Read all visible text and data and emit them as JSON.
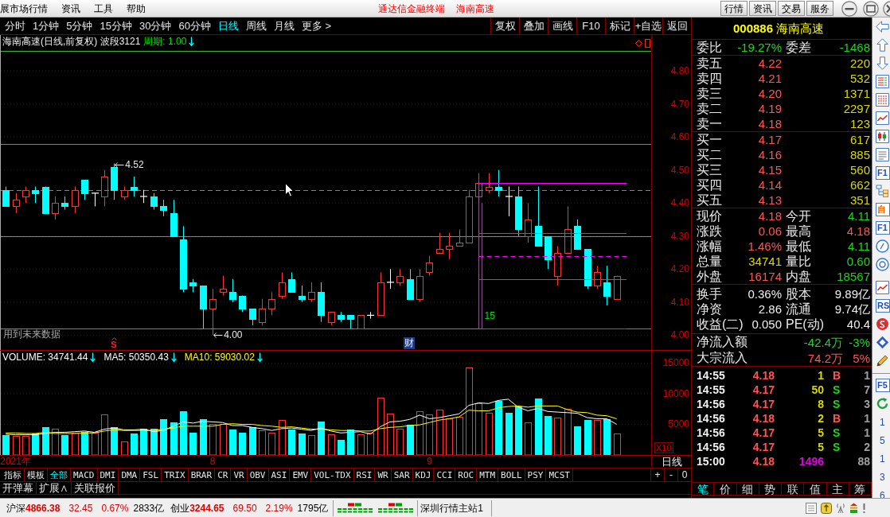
{
  "title_bar": {
    "menus": [
      "展市场行情",
      "资讯",
      "工具",
      "帮助"
    ],
    "app_name": "通达信金融终端",
    "stock_name": "海南高速",
    "buttons": [
      "行情",
      "资讯",
      "交易",
      "服务"
    ]
  },
  "toolbar": {
    "periods": [
      {
        "label": "分时",
        "selected": false
      },
      {
        "label": "1分钟",
        "selected": false
      },
      {
        "label": "5分钟",
        "selected": false
      },
      {
        "label": "15分钟",
        "selected": false
      },
      {
        "label": "30分钟",
        "selected": false
      },
      {
        "label": "60分钟",
        "selected": false
      },
      {
        "label": "日线",
        "selected": true
      },
      {
        "label": "周线",
        "selected": false
      },
      {
        "label": "月线",
        "selected": false
      },
      {
        "label": "更多 >",
        "selected": false
      }
    ],
    "tools": [
      "复权",
      "叠加",
      "画线",
      "F10",
      "标记",
      "+自选",
      "返回"
    ]
  },
  "price_panel": {
    "title": "海南高速(日线,前复权) 波段3121",
    "period_label": "周期: 1.00",
    "notice": "用到未来数据",
    "chart_data": [
      {
        "type": "candlestick",
        "ohlc": [
          [
            4.44,
            4.45,
            4.39,
            4.39
          ],
          [
            4.39,
            4.43,
            4.37,
            4.41
          ],
          [
            4.42,
            4.45,
            4.4,
            4.44
          ],
          [
            4.44,
            4.45,
            4.4,
            4.43
          ],
          [
            4.45,
            4.45,
            4.37,
            4.37
          ],
          [
            4.37,
            4.42,
            4.35,
            4.4
          ],
          [
            4.4,
            4.42,
            4.38,
            4.39
          ],
          [
            4.39,
            4.45,
            4.37,
            4.44
          ],
          [
            4.47,
            4.47,
            4.41,
            4.43
          ],
          [
            4.43,
            4.43,
            4.39,
            4.43
          ],
          [
            4.42,
            4.5,
            4.39,
            4.48
          ],
          [
            4.51,
            4.52,
            4.41,
            4.44
          ],
          [
            4.42,
            4.45,
            4.41,
            4.44
          ],
          [
            4.45,
            4.48,
            4.42,
            4.44
          ],
          [
            4.42,
            4.44,
            4.4,
            4.42
          ],
          [
            4.42,
            4.43,
            4.38,
            4.39
          ],
          [
            4.39,
            4.41,
            4.36,
            4.38
          ],
          [
            4.37,
            4.41,
            4.3,
            4.3
          ],
          [
            4.29,
            4.33,
            4.13,
            4.14
          ],
          [
            4.16,
            4.17,
            4.13,
            4.15
          ],
          [
            4.15,
            4.15,
            4.02,
            4.08
          ],
          [
            4.08,
            4.14,
            4.0,
            4.11
          ],
          [
            4.13,
            4.18,
            4.12,
            4.14
          ],
          [
            4.13,
            4.17,
            4.1,
            4.11
          ],
          [
            4.12,
            4.12,
            4.07,
            4.08
          ],
          [
            4.08,
            4.08,
            4.03,
            4.05
          ],
          [
            4.04,
            4.11,
            4.03,
            4.08
          ],
          [
            4.08,
            4.13,
            4.06,
            4.11
          ],
          [
            4.12,
            4.19,
            4.11,
            4.16
          ],
          [
            4.17,
            4.19,
            4.13,
            4.13
          ],
          [
            4.12,
            4.15,
            4.1,
            4.11
          ],
          [
            4.11,
            4.16,
            4.1,
            4.13
          ],
          [
            4.13,
            4.16,
            4.04,
            4.06
          ],
          [
            4.04,
            4.07,
            4.03,
            4.07
          ],
          [
            4.06,
            4.07,
            4.04,
            4.05
          ],
          [
            4.06,
            4.06,
            4.02,
            4.05
          ],
          [
            4.02,
            4.06,
            4.02,
            4.06
          ],
          [
            4.06,
            4.07,
            4.05,
            4.06
          ],
          [
            4.06,
            4.19,
            4.06,
            4.16
          ],
          [
            4.16,
            4.2,
            4.14,
            4.16
          ],
          [
            4.16,
            4.2,
            4.15,
            4.18
          ],
          [
            4.17,
            4.2,
            4.11,
            4.11
          ],
          [
            4.11,
            4.2,
            4.1,
            4.18
          ],
          [
            4.19,
            4.24,
            4.18,
            4.22
          ],
          [
            4.25,
            4.31,
            4.25,
            4.26
          ],
          [
            4.26,
            4.31,
            4.23,
            4.27
          ],
          [
            4.27,
            4.32,
            4.27,
            4.28
          ],
          [
            4.28,
            4.44,
            4.28,
            4.42
          ],
          [
            4.42,
            4.49,
            4.4,
            4.46
          ],
          [
            4.44,
            4.49,
            4.43,
            4.45
          ],
          [
            4.45,
            4.5,
            4.42,
            4.44
          ],
          [
            4.42,
            4.45,
            4.36,
            4.42
          ],
          [
            4.42,
            4.45,
            4.3,
            4.32
          ],
          [
            4.3,
            4.4,
            4.28,
            4.35
          ],
          [
            4.33,
            4.45,
            4.27,
            4.27
          ],
          [
            4.3,
            4.3,
            4.2,
            4.23
          ],
          [
            4.18,
            4.27,
            4.15,
            4.25
          ],
          [
            4.25,
            4.39,
            4.25,
            4.32
          ],
          [
            4.33,
            4.35,
            4.26,
            4.26
          ],
          [
            4.26,
            4.26,
            4.14,
            4.15
          ],
          [
            4.15,
            4.21,
            4.14,
            4.19
          ],
          [
            4.16,
            4.21,
            4.09,
            4.12
          ],
          [
            4.11,
            4.18,
            4.11,
            4.18
          ],
          null,
          null,
          null
        ],
        "series": [
          {
            "type": "line",
            "color": "#ff00ff",
            "line_style": "solid",
            "values": [
              null,
              null,
              null,
              null,
              null,
              null,
              null,
              null,
              null,
              null,
              null,
              null,
              null,
              null,
              null,
              null,
              null,
              null,
              null,
              null,
              null,
              null,
              null,
              null,
              null,
              null,
              null,
              null,
              null,
              null,
              null,
              null,
              null,
              null,
              null,
              null,
              null,
              null,
              null,
              null,
              null,
              null,
              null,
              null,
              null,
              null,
              null,
              null,
              4.46,
              4.46,
              4.46,
              4.46,
              4.46,
              4.46,
              4.46,
              4.46,
              4.46,
              4.46,
              4.46,
              4.46,
              4.46,
              4.46,
              4.46,
              4.46,
              null,
              null
            ]
          },
          {
            "type": "line",
            "color": "#ff00ff",
            "line_style": "solid",
            "values": [
              null,
              null,
              null,
              null,
              null,
              null,
              null,
              null,
              null,
              null,
              null,
              null,
              null,
              null,
              null,
              null,
              null,
              null,
              null,
              null,
              null,
              null,
              null,
              null,
              null,
              null,
              null,
              null,
              null,
              null,
              null,
              null,
              null,
              null,
              null,
              null,
              null,
              null,
              null,
              null,
              null,
              null,
              null,
              null,
              null,
              null,
              null,
              null,
              4.31,
              4.31,
              4.31,
              4.31,
              4.31,
              4.31,
              4.31,
              4.31,
              4.31,
              4.31,
              4.31,
              4.31,
              4.31,
              4.31,
              4.31,
              4.31,
              null,
              null
            ]
          },
          {
            "type": "line",
            "color": "#ff00ff",
            "line_style": "dashed",
            "values": [
              null,
              null,
              null,
              null,
              null,
              null,
              null,
              null,
              null,
              null,
              null,
              null,
              null,
              null,
              null,
              null,
              null,
              null,
              null,
              null,
              null,
              null,
              null,
              null,
              null,
              null,
              null,
              null,
              null,
              null,
              null,
              null,
              null,
              null,
              null,
              null,
              null,
              null,
              null,
              null,
              null,
              null,
              null,
              null,
              null,
              null,
              null,
              null,
              4.24,
              4.24,
              4.24,
              4.24,
              4.24,
              4.24,
              4.24,
              4.24,
              4.24,
              4.24,
              4.24,
              4.24,
              4.24,
              4.24,
              4.24,
              4.24,
              null,
              null
            ]
          },
          {
            "type": "line",
            "color": "#ff00ff",
            "line_style": "solid",
            "values": [
              null,
              null,
              null,
              null,
              null,
              null,
              null,
              null,
              null,
              null,
              null,
              null,
              null,
              null,
              null,
              null,
              null,
              null,
              null,
              null,
              null,
              null,
              null,
              null,
              null,
              null,
              null,
              null,
              null,
              null,
              null,
              null,
              null,
              null,
              null,
              null,
              null,
              null,
              null,
              null,
              null,
              null,
              null,
              null,
              null,
              null,
              null,
              null,
              4.17,
              4.17,
              4.17,
              4.17,
              4.17,
              4.17,
              4.17,
              4.17,
              4.17,
              4.17,
              4.17,
              4.17,
              4.17,
              4.17,
              4.17,
              4.17,
              null,
              null
            ]
          },
          {
            "type": "line",
            "color": "#ff00ff",
            "line_style": "solid",
            "values": [
              null,
              null,
              null,
              null,
              null,
              null,
              null,
              null,
              null,
              null,
              null,
              null,
              null,
              null,
              null,
              null,
              null,
              null,
              null,
              null,
              null,
              null,
              null,
              null,
              null,
              null,
              null,
              null,
              null,
              null,
              null,
              null,
              null,
              null,
              null,
              null,
              null,
              null,
              null,
              null,
              null,
              null,
              null,
              null,
              null,
              null,
              null,
              null,
              4.02,
              4.02,
              4.02,
              4.02,
              4.02,
              4.02,
              4.02,
              4.02,
              4.02,
              4.02,
              4.02,
              4.02,
              4.02,
              4.02,
              4.02,
              4.02,
              null,
              null
            ]
          }
        ],
        "ylim": [
          3.955,
          4.909
        ],
        "yticks": [
          {
            "value": 4.0,
            "label": "4.00"
          },
          {
            "value": 4.1,
            "label": "4.10"
          },
          {
            "value": 4.2,
            "label": "4.20"
          },
          {
            "value": 4.3,
            "label": "4.30"
          },
          {
            "value": 4.4,
            "label": "4.40"
          },
          {
            "value": 4.5,
            "label": "4.50"
          },
          {
            "value": 4.6,
            "label": "4.60"
          },
          {
            "value": 4.7,
            "label": "4.70"
          },
          {
            "value": 4.8,
            "label": "4.80"
          }
        ],
        "grid": true,
        "ref_lines": [
          {
            "axis": "y",
            "value": 4.86,
            "color": "#3cb43c",
            "line_style": "solid"
          },
          {
            "axis": "y",
            "value": 4.58,
            "color": "#3cb43c",
            "line_style": "solid"
          },
          {
            "axis": "y",
            "value": 4.44,
            "color": "#3cb43c",
            "line_style": "dashed"
          },
          {
            "axis": "y",
            "value": 4.3,
            "color": "#3cb43c",
            "line_style": "solid"
          },
          {
            "axis": "y",
            "value": 4.02,
            "color": "#3cb43c",
            "line_style": "solid"
          }
        ],
        "annotations": [
          "4.52",
          "4.00",
          "S",
          "财",
          "15"
        ]
      }
    ]
  },
  "volume_panel": {
    "readouts": [
      {
        "text": "VOLUME: 34741.44",
        "color": "#ffffff"
      },
      {
        "text": "MA5: 50350.43",
        "color": "#ffffff"
      },
      {
        "text": "MA10: 59030.02",
        "color": "#ffff00"
      }
    ],
    "chart_data": [
      {
        "type": "bar",
        "categories": [
          null,
          "2021年",
          null,
          null,
          null,
          null,
          null,
          null,
          null,
          null,
          null,
          null,
          null,
          null,
          null,
          null,
          null,
          null,
          null,
          null,
          null,
          "8",
          null,
          null,
          null,
          null,
          null,
          null,
          null,
          null,
          null,
          null,
          null,
          null,
          null,
          null,
          null,
          null,
          null,
          null,
          null,
          null,
          null,
          "9",
          null,
          null,
          null,
          null,
          null,
          null,
          null,
          null,
          null,
          null,
          null,
          null,
          null,
          null,
          null,
          null,
          null,
          null,
          null,
          null,
          null,
          null
        ],
        "ylim": [
          0,
          17000
        ],
        "yticks": [
          5000,
          10000,
          15000
        ],
        "ylabel": "X10",
        "grid": true,
        "series": [
          {
            "type": "bar",
            "values": [
              3300,
              3100,
              3100,
              3500,
              4500,
              4300,
              3200,
              3600,
              3800,
              3600,
              6600,
              4500,
              2200,
              3500,
              4300,
              4300,
              5900,
              5300,
              7100,
              3600,
              5800,
              5100,
              5100,
              4200,
              3600,
              4500,
              4000,
              3600,
              5700,
              4200,
              3500,
              3200,
              5400,
              3400,
              2500,
              4100,
              3400,
              3600,
              9300,
              6700,
              4300,
              4900,
              7100,
              6600,
              7400,
              6000,
              6200,
              14300,
              8500,
              6900,
              8800,
              6900,
              7900,
              5300,
              9200,
              6400,
              6100,
              7500,
              4700,
              5700,
              5700,
              5900,
              3500,
              null,
              null,
              null
            ],
            "colors": [
              "#00ffff",
              "#ff3232",
              "#ff3232",
              "#00ffff",
              "#00ffff",
              "#ff3232",
              "#00ffff",
              "#ff3232",
              "#00ffff",
              "#ff3232",
              "#ff3232",
              "#00ffff",
              "#ff3232",
              "#00ffff",
              "#00ffff",
              "#00ffff",
              "#00ffff",
              "#00ffff",
              "#00ffff",
              "#00ffff",
              "#00ffff",
              "#ff3232",
              "#ff3232",
              "#00ffff",
              "#00ffff",
              "#00ffff",
              "#ff3232",
              "#ff3232",
              "#ff3232",
              "#00ffff",
              "#00ffff",
              "#ff3232",
              "#00ffff",
              "#ff3232",
              "#00ffff",
              "#00ffff",
              "#ff3232",
              "#ff3232",
              "#ff3232",
              "#ff3232",
              "#ff3232",
              "#00ffff",
              "#ff3232",
              "#ff3232",
              "#ff3232",
              "#ff3232",
              "#ff3232",
              "#ff3232",
              "#ff3232",
              "#ff3232",
              "#00ffff",
              "#00ffff",
              "#00ffff",
              "#ff3232",
              "#00ffff",
              "#00ffff",
              "#ff3232",
              "#ff3232",
              "#00ffff",
              "#00ffff",
              "#ff3232",
              "#00ffff",
              "#ff3232",
              null,
              null,
              null
            ]
          },
          {
            "type": "line",
            "color": "#ffffff",
            "values": [
              3400,
              3300,
              3300,
              3300,
              3500,
              3700,
              3700,
              3800,
              3900,
              3700,
              4200,
              4400,
              4100,
              4100,
              4200,
              3800,
              4000,
              4700,
              5400,
              5200,
              5500,
              5400,
              5300,
              4800,
              4800,
              4500,
              4300,
              4000,
              4300,
              4400,
              4200,
              4000,
              4400,
              3900,
              3600,
              3700,
              3800,
              3400,
              4600,
              5400,
              5500,
              5800,
              6500,
              5900,
              6100,
              6400,
              6700,
              8100,
              8500,
              8400,
              8900,
              9100,
              7800,
              7200,
              7600,
              7100,
              7000,
              6900,
              6800,
              6100,
              5900,
              5900,
              5000,
              null,
              null,
              null
            ]
          },
          {
            "type": "line",
            "color": "#ffff00",
            "values": [
              3600,
              3600,
              3500,
              3500,
              3700,
              3500,
              3500,
              3500,
              3600,
              3600,
              3900,
              4100,
              4000,
              4000,
              4000,
              4000,
              4200,
              4400,
              4700,
              4700,
              4700,
              4700,
              5000,
              5100,
              5000,
              5000,
              4800,
              4700,
              4500,
              4600,
              4400,
              4200,
              4200,
              4100,
              4000,
              4000,
              3900,
              3900,
              4300,
              4500,
              4600,
              4800,
              4900,
              5300,
              5700,
              5900,
              6200,
              7300,
              7200,
              7200,
              7700,
              7900,
              8000,
              7800,
              8000,
              8000,
              8000,
              7400,
              7000,
              6900,
              6500,
              6400,
              5900,
              null,
              null,
              null
            ]
          }
        ]
      }
    ]
  },
  "date_axis": {
    "period": "日线"
  },
  "indicator_bar": {
    "tabs": [
      {
        "label": "指标",
        "selected": false
      },
      {
        "label": "模板",
        "selected": false
      },
      {
        "label": "全部",
        "selected": true
      },
      {
        "label": "MACD",
        "selected": false
      },
      {
        "label": "DMI",
        "selected": false
      },
      {
        "label": "DMA",
        "selected": false
      },
      {
        "label": "FSL",
        "selected": false
      },
      {
        "label": "TRIX",
        "selected": false
      },
      {
        "label": "BRAR",
        "selected": false
      },
      {
        "label": "CR",
        "selected": false
      },
      {
        "label": "VR",
        "selected": false
      },
      {
        "label": "OBV",
        "selected": false
      },
      {
        "label": "ASI",
        "selected": false
      },
      {
        "label": "EMV",
        "selected": false
      },
      {
        "label": "VOL-TDX",
        "selected": false
      },
      {
        "label": "RSI",
        "selected": false
      },
      {
        "label": "WR",
        "selected": false
      },
      {
        "label": "SAR",
        "selected": false
      },
      {
        "label": "KDJ",
        "selected": false
      },
      {
        "label": "CCI",
        "selected": false
      },
      {
        "label": "ROC",
        "selected": false
      },
      {
        "label": "MTM",
        "selected": false
      },
      {
        "label": "BOLL",
        "selected": false
      },
      {
        "label": "PSY",
        "selected": false
      },
      {
        "label": "MCST",
        "selected": false
      }
    ],
    "zoom_buttons": [
      "+",
      "-",
      "0"
    ]
  },
  "extra_bar": {
    "buttons": [
      "开弹幕",
      "扩展∧",
      "关联报价"
    ]
  },
  "quote_panel": {
    "code": "000886",
    "name": "海南高速",
    "order_ratio": [
      {
        "label": "委比",
        "value": "-19.27%",
        "color": "#18d818"
      },
      {
        "label": "委差",
        "value": "-1468",
        "color": "#18d818"
      }
    ],
    "asks": [
      {
        "label": "卖五",
        "price": "4.22",
        "volume": "220"
      },
      {
        "label": "卖四",
        "price": "4.21",
        "volume": "532"
      },
      {
        "label": "卖三",
        "price": "4.20",
        "volume": "1371"
      },
      {
        "label": "卖二",
        "price": "4.19",
        "volume": "2297"
      },
      {
        "label": "卖一",
        "price": "4.18",
        "volume": "123"
      }
    ],
    "bids": [
      {
        "label": "买一",
        "price": "4.17",
        "volume": "617"
      },
      {
        "label": "买二",
        "price": "4.16",
        "volume": "885"
      },
      {
        "label": "买三",
        "price": "4.15",
        "volume": "560"
      },
      {
        "label": "买四",
        "price": "4.14",
        "volume": "662"
      },
      {
        "label": "买五",
        "price": "4.13",
        "volume": "351"
      }
    ],
    "stats": [
      {
        "label": "现价",
        "value": "4.18",
        "color": "#ff5454"
      },
      {
        "label": "今开",
        "value": "4.11",
        "color": "#18d818"
      },
      {
        "label": "涨跌",
        "value": "0.06",
        "color": "#ff5454"
      },
      {
        "label": "最高",
        "value": "4.18",
        "color": "#ff5454"
      },
      {
        "label": "涨幅",
        "value": "1.46%",
        "color": "#ff5454"
      },
      {
        "label": "最低",
        "value": "4.11",
        "color": "#18d818"
      },
      {
        "label": "总量",
        "value": "34741",
        "color": "#d8d800"
      },
      {
        "label": "量比",
        "value": "0.60",
        "color": "#18d818"
      },
      {
        "label": "外盘",
        "value": "16174",
        "color": "#ff5454"
      },
      {
        "label": "内盘",
        "value": "18567",
        "color": "#18d818"
      }
    ],
    "fundamentals": [
      {
        "label": "换手",
        "value": "0.36%"
      },
      {
        "label": "股本",
        "value": "9.89亿"
      },
      {
        "label": "净资",
        "value": "2.86"
      },
      {
        "label": "流通",
        "value": "9.74亿"
      },
      {
        "label": "收益(二)",
        "value": "0.050"
      },
      {
        "label": "PE(动)",
        "value": "40.4"
      }
    ],
    "flows": [
      {
        "label": "净流入额",
        "amount": "-42.4万",
        "percent": "-3%",
        "color": "#18d818"
      },
      {
        "label": "大宗流入",
        "amount": "74.2万",
        "percent": "5%",
        "color": "#ff5454"
      }
    ],
    "ticks": [
      {
        "kind": "trade",
        "time": "14:55",
        "price": "4.18",
        "volume": "1",
        "side": "B",
        "color": "#ff5454",
        "count": "1"
      },
      {
        "kind": "trade",
        "time": "14:55",
        "price": "4.17",
        "volume": "50",
        "side": "S",
        "color": "#18d818",
        "count": "7"
      },
      {
        "kind": "trade",
        "time": "14:56",
        "price": "4.17",
        "volume": "8",
        "side": "S",
        "color": "#18d818",
        "count": "3"
      },
      {
        "kind": "trade",
        "time": "14:56",
        "price": "4.18",
        "volume": "2",
        "side": "B",
        "color": "#ff5454",
        "count": "1"
      },
      {
        "kind": "trade",
        "time": "14:56",
        "price": "4.17",
        "volume": "5",
        "side": "S",
        "color": "#18d818",
        "count": "1"
      },
      {
        "kind": "trade",
        "time": "14:56",
        "price": "4.17",
        "volume": "5",
        "side": "S",
        "color": "#18d818",
        "count": "2"
      },
      {
        "kind": "close",
        "time": "15:00",
        "price": "4.18",
        "volume": "1496",
        "count": "88"
      }
    ],
    "tabs": [
      {
        "label": "笔",
        "selected": true
      },
      {
        "label": "价",
        "selected": false
      },
      {
        "label": "细",
        "selected": false
      },
      {
        "label": "势",
        "selected": false
      },
      {
        "label": "联",
        "selected": false
      },
      {
        "label": "值",
        "selected": false
      },
      {
        "label": "主",
        "selected": false
      },
      {
        "label": "筹",
        "selected": false
      }
    ]
  },
  "side_strip": {
    "badges": [
      "F1",
      "自",
      "F1",
      "RS",
      "F5"
    ],
    "labels": [
      "1",
      "5",
      "1",
      "3",
      "6"
    ]
  },
  "status_bar": {
    "indices": [
      {
        "name": "沪深",
        "value": "4866.38",
        "change": "32.45",
        "percent": "0.67%",
        "amount": "2833亿",
        "color": "#e00000"
      },
      {
        "name": "创业",
        "value": "3244.65",
        "change": "69.50",
        "percent": "2.19%",
        "amount": "1795亿",
        "color": "#e00000"
      }
    ],
    "server": "深圳行情主站1"
  }
}
